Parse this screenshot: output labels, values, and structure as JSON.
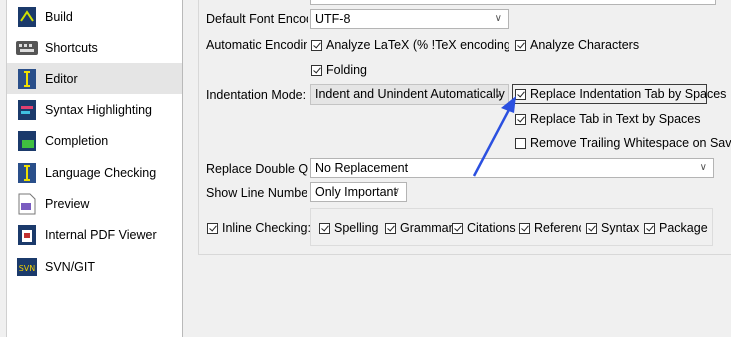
{
  "sidebar": {
    "items": [
      {
        "label": "Build",
        "icon": "build-icon"
      },
      {
        "label": "Shortcuts",
        "icon": "shortcuts-icon"
      },
      {
        "label": "Editor",
        "icon": "editor-icon",
        "selected": true
      },
      {
        "label": "Syntax Highlighting",
        "icon": "syntax-highlighting-icon"
      },
      {
        "label": "Completion",
        "icon": "completion-icon"
      },
      {
        "label": "Language Checking",
        "icon": "language-checking-icon"
      },
      {
        "label": "Preview",
        "icon": "preview-icon"
      },
      {
        "label": "Internal PDF Viewer",
        "icon": "pdf-viewer-icon"
      },
      {
        "label": "SVN/GIT",
        "icon": "svn-git-icon"
      }
    ]
  },
  "editor": {
    "default_font_encoding": {
      "label": "Default Font Encodi",
      "value": "UTF-8"
    },
    "automatic_encoding": {
      "label": "Automatic Encoding",
      "analyze_latex": {
        "label": "Analyze LaTeX (% !TeX encoding, inpu",
        "checked": true
      },
      "analyze_characters": {
        "label": "Analyze Characters",
        "checked": true
      }
    },
    "folding": {
      "label": "Folding",
      "checked": true
    },
    "indentation_mode": {
      "label": "Indentation Mode:",
      "value": "Indent and Unindent Automatically"
    },
    "replace_indentation_tab": {
      "label": "Replace Indentation Tab by Spaces",
      "checked": true
    },
    "replace_tab_in_text": {
      "label": "Replace Tab in Text by Spaces",
      "checked": true
    },
    "remove_trailing_whitespace": {
      "label": "Remove Trailing Whitespace on Save",
      "checked": false
    },
    "replace_double_quotes": {
      "label": "Replace Double Qu",
      "value": "No Replacement"
    },
    "show_line_numbers": {
      "label": "Show Line Numbers",
      "value": "Only Important"
    },
    "inline_checking": {
      "label": "Inline Checking:",
      "checked": true,
      "options": [
        {
          "label": "Spelling",
          "checked": true
        },
        {
          "label": "Grammar",
          "checked": true
        },
        {
          "label": "Citations",
          "checked": true
        },
        {
          "label": "Reference",
          "checked": true
        },
        {
          "label": "Syntax",
          "checked": true
        },
        {
          "label": "Package",
          "checked": true
        }
      ]
    }
  },
  "annotation": {
    "color": "#2b50e0"
  }
}
